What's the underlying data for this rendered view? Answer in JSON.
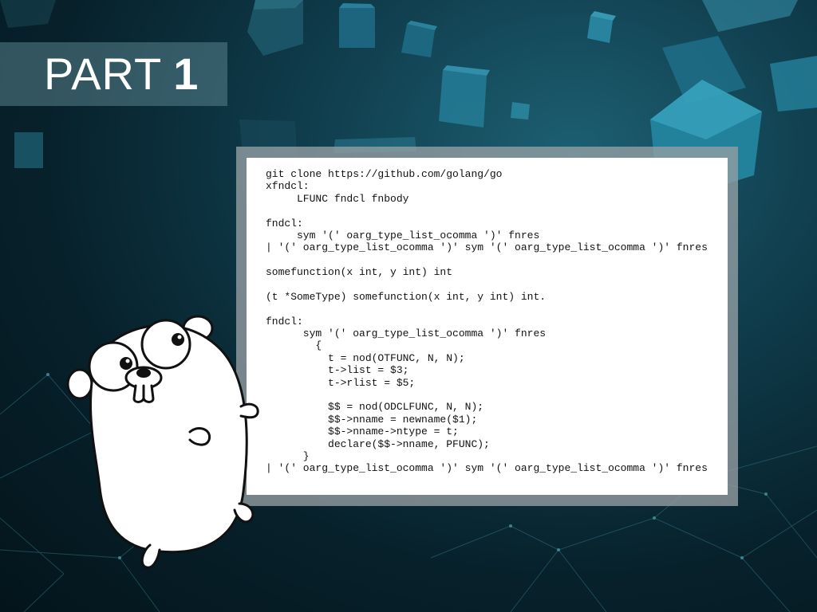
{
  "slide": {
    "title_word": "PART",
    "title_number": "1",
    "accent_color": "#1c6f86",
    "band_color": "#58828c"
  },
  "code": {
    "lines": [
      "git clone https://github.com/golang/go",
      "xfndcl:",
      "     LFUNC fndcl fnbody",
      "",
      "fndcl:",
      "     sym '(' oarg_type_list_ocomma ')' fnres",
      "| '(' oarg_type_list_ocomma ')' sym '(' oarg_type_list_ocomma ')' fnres",
      "",
      "somefunction(x int, y int) int",
      "",
      "(t *SomeType) somefunction(x int, y int) int.",
      "",
      "fndcl:",
      "      sym '(' oarg_type_list_ocomma ')' fnres",
      "        {",
      "          t = nod(OTFUNC, N, N);",
      "          t->list = $3;",
      "          t->rlist = $5;",
      "",
      "          $$ = nod(ODCLFUNC, N, N);",
      "          $$->nname = newname($1);",
      "          $$->nname->ntype = t;",
      "          declare($$->nname, PFUNC);",
      "      }",
      "| '(' oarg_type_list_ocomma ')' sym '(' oarg_type_list_ocomma ')' fnres"
    ]
  },
  "illustration": {
    "icon": "gopher-mascot-icon"
  }
}
